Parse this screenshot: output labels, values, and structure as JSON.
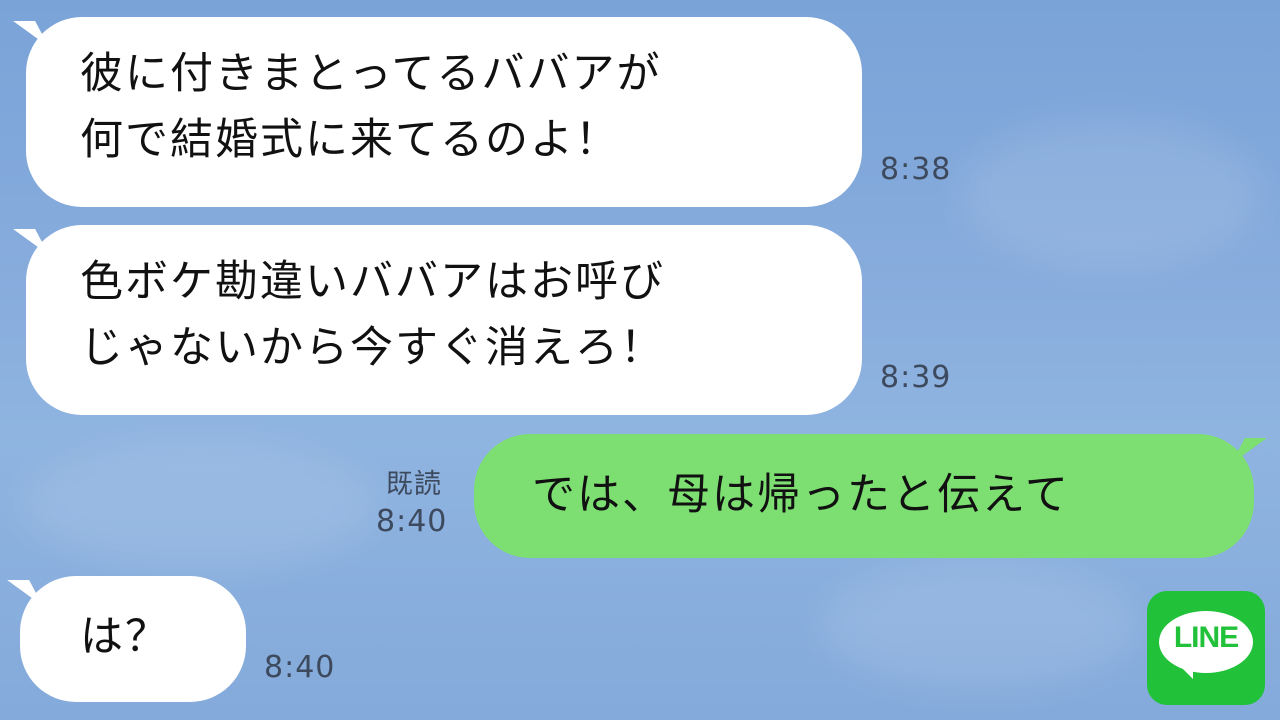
{
  "chat": {
    "messages": [
      {
        "side": "in",
        "text": "彼に付きまとってるババアが\n何で結婚式に来てるのよ！",
        "time": "8:38"
      },
      {
        "side": "in",
        "text": "色ボケ勘違いババアはお呼び\nじゃないから今すぐ消えろ！",
        "time": "8:39"
      },
      {
        "side": "out",
        "text": "では、母は帰ったと伝えて",
        "time": "8:40",
        "read_label": "既読"
      },
      {
        "side": "in",
        "text": "は？",
        "time": "8:40"
      }
    ]
  },
  "logo": {
    "text": "LINE",
    "icon": "line-app-icon"
  },
  "colors": {
    "background": "#84aadb",
    "incoming_bubble": "#ffffff",
    "outgoing_bubble": "#7ddf72",
    "timestamp": "#3d4a5e",
    "logo_green": "#22c13a"
  }
}
